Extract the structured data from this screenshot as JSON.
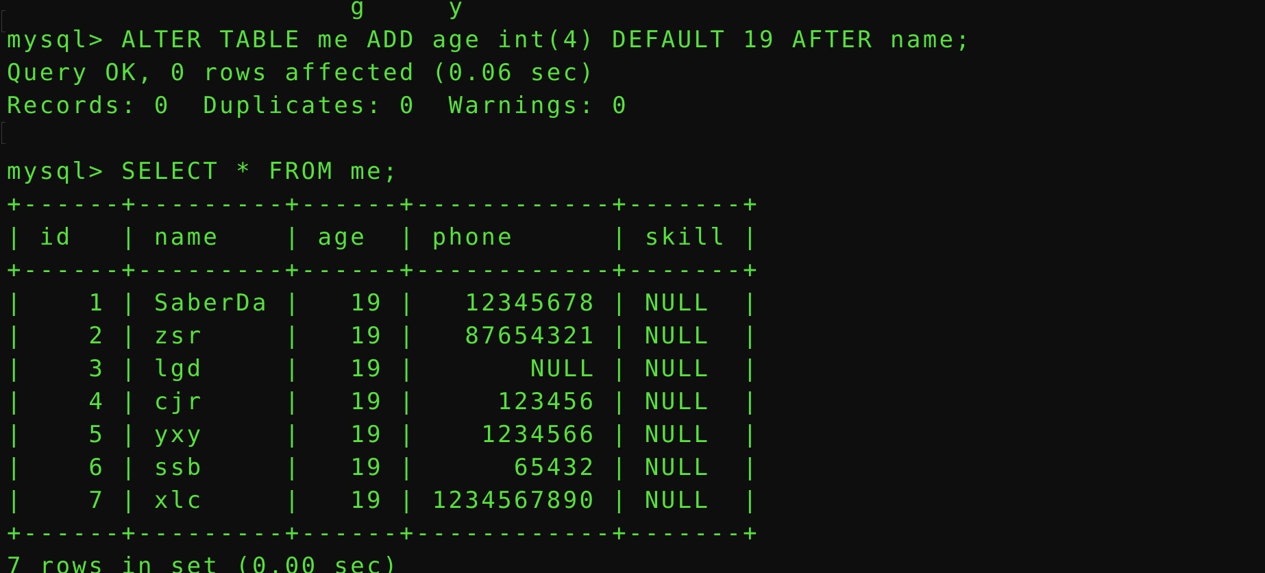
{
  "theme": {
    "background": "#0e0e0e",
    "text_color": "#56e23a"
  },
  "terminal": {
    "lines": [
      "                     g     y",
      "mysql> ALTER TABLE me ADD age int(4) DEFAULT 19 AFTER name;",
      "Query OK, 0 rows affected (0.06 sec)",
      "Records: 0  Duplicates: 0  Warnings: 0",
      "",
      "mysql> SELECT * FROM me;",
      "+------+---------+------+------------+-------+",
      "| id   | name    | age  | phone      | skill |",
      "+------+---------+------+------------+-------+",
      "|    1 | SaberDa |   19 |   12345678 | NULL  |",
      "|    2 | zsr     |   19 |   87654321 | NULL  |",
      "|    3 | lgd     |   19 |       NULL | NULL  |",
      "|    4 | cjr     |   19 |     123456 | NULL  |",
      "|    5 | yxy     |   19 |    1234566 | NULL  |",
      "|    6 | ssb     |   19 |      65432 | NULL  |",
      "|    7 | xlc     |   19 | 1234567890 | NULL  |",
      "+------+---------+------+------------+-------+",
      "7 rows in set (0.00 sec)"
    ]
  }
}
